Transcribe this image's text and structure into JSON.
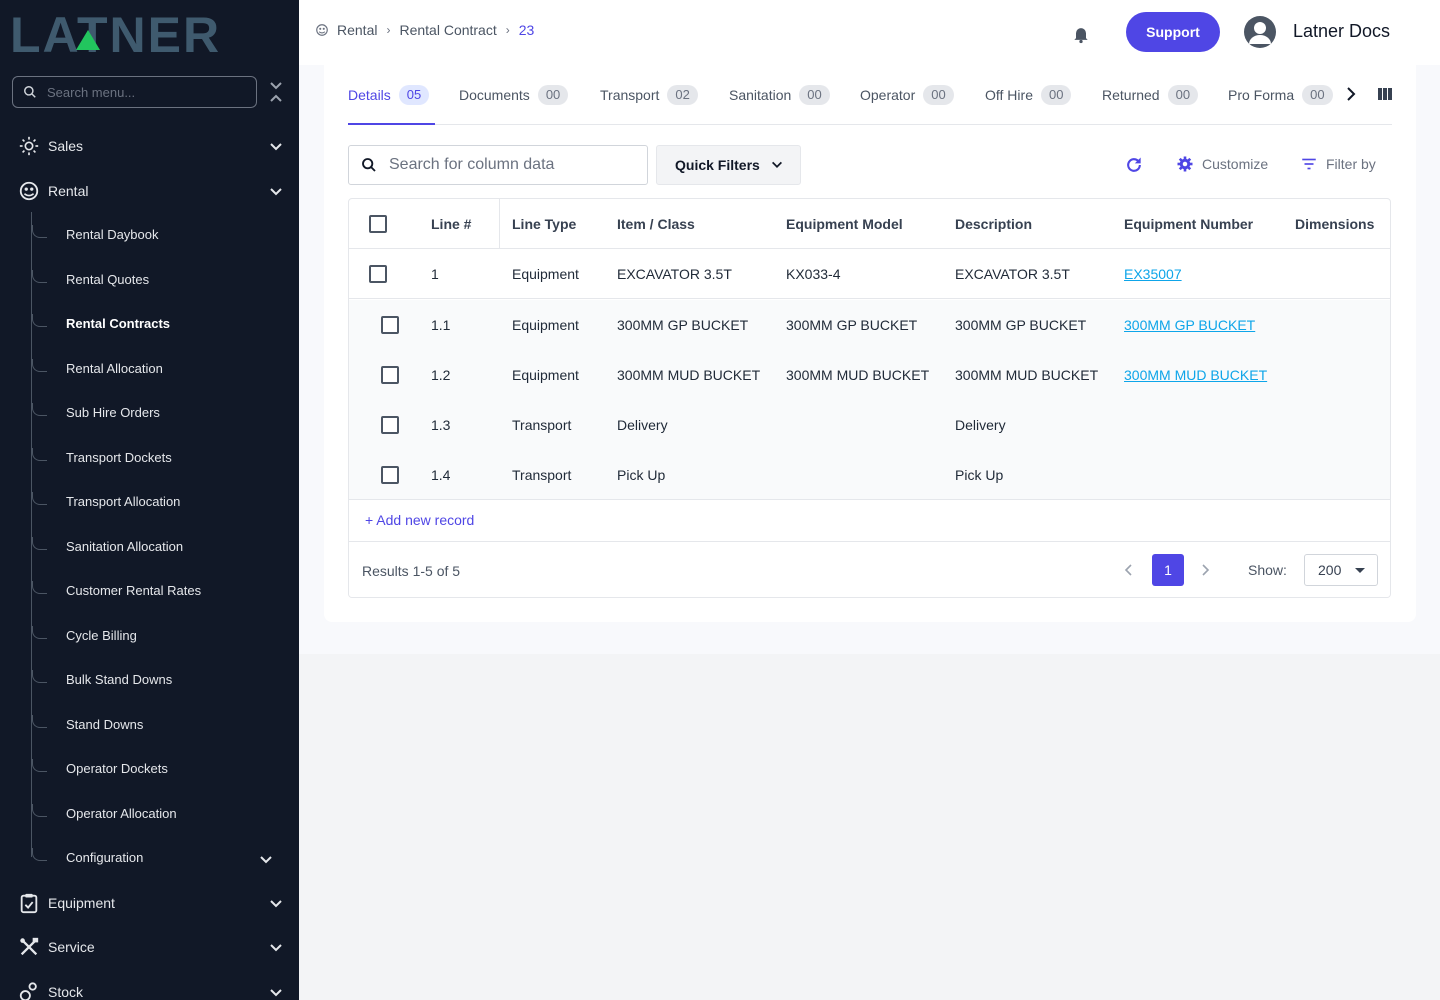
{
  "brand": {
    "logo_text": "LATNER"
  },
  "sidebar": {
    "search_placeholder": "Search menu...",
    "top": {
      "sales": "Sales",
      "rental": "Rental",
      "equipment": "Equipment",
      "service": "Service",
      "stock": "Stock"
    },
    "rental_items": [
      "Rental Daybook",
      "Rental Quotes",
      "Rental Contracts",
      "Rental Allocation",
      "Sub Hire Orders",
      "Transport Dockets",
      "Transport Allocation",
      "Sanitation Allocation",
      "Customer Rental Rates",
      "Cycle Billing",
      "Bulk Stand Downs",
      "Stand Downs",
      "Operator Dockets",
      "Operator Allocation",
      "Configuration"
    ]
  },
  "header": {
    "breadcrumb": [
      "Rental",
      "Rental Contract",
      "23"
    ],
    "support_label": "Support",
    "user_name": "Latner Docs"
  },
  "tabs": [
    {
      "label": "Details",
      "count": "05"
    },
    {
      "label": "Documents",
      "count": "00"
    },
    {
      "label": "Transport",
      "count": "02"
    },
    {
      "label": "Sanitation",
      "count": "00"
    },
    {
      "label": "Operator",
      "count": "00"
    },
    {
      "label": "Off Hire",
      "count": "00"
    },
    {
      "label": "Returned",
      "count": "00"
    },
    {
      "label": "Pro Forma",
      "count": "00"
    }
  ],
  "toolbar": {
    "search_placeholder": "Search for column data",
    "quick_filters": "Quick Filters",
    "customize": "Customize",
    "filter_by": "Filter by"
  },
  "table": {
    "columns": [
      "Line #",
      "Line Type",
      "Item / Class",
      "Equipment Model",
      "Description",
      "Equipment Number",
      "Dimensions"
    ],
    "rows": [
      {
        "line": "1",
        "type": "Equipment",
        "item": "EXCAVATOR 3.5T",
        "model": "KX033-4",
        "desc": "EXCAVATOR 3.5T",
        "equip": "EX35007",
        "dims": ""
      },
      {
        "line": "1.1",
        "type": "Equipment",
        "item": "300MM GP BUCKET",
        "model": "300MM GP BUCKET",
        "desc": "300MM GP BUCKET",
        "equip": "300MM GP BUCKET",
        "dims": ""
      },
      {
        "line": "1.2",
        "type": "Equipment",
        "item": "300MM MUD BUCKET",
        "model": "300MM MUD BUCKET",
        "desc": "300MM MUD BUCKET",
        "equip": "300MM MUD BUCKET",
        "dims": ""
      },
      {
        "line": "1.3",
        "type": "Transport",
        "item": "Delivery",
        "model": "",
        "desc": "Delivery",
        "equip": "",
        "dims": ""
      },
      {
        "line": "1.4",
        "type": "Transport",
        "item": "Pick Up",
        "model": "",
        "desc": "Pick Up",
        "equip": "",
        "dims": ""
      }
    ],
    "add_record": "+ Add new record"
  },
  "pagination": {
    "results": "Results 1-5 of 5",
    "current_page": "1",
    "show_label": "Show:",
    "page_size": "200"
  },
  "colors": {
    "accent": "#4f46e5",
    "sidebar_bg": "#111827",
    "link": "#0ea5e9",
    "logo_fill": "#3f5a6e",
    "logo_accent": "#22c55e"
  }
}
